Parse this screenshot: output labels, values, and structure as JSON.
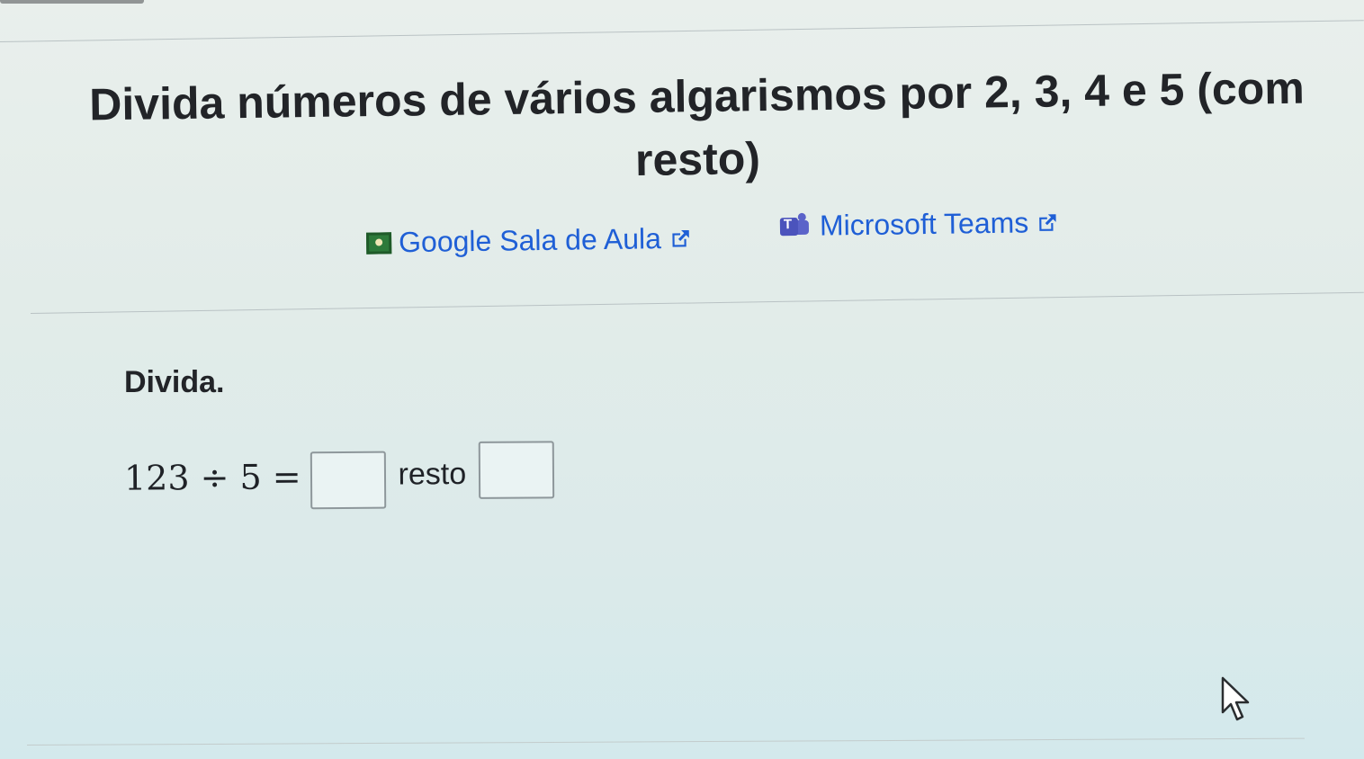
{
  "page": {
    "title": "Divida números de vários algarismos por 2, 3, 4 e 5 (com resto)",
    "share": {
      "google_label": "Google Sala de Aula",
      "teams_label": "Microsoft Teams",
      "google_icon": "google-classroom-icon",
      "teams_icon": "microsoft-teams-icon",
      "external_icon": "external-link-icon"
    }
  },
  "exercise": {
    "instruction": "Divida.",
    "expression": "123 ÷ 5 =",
    "quotient_value": "",
    "remainder_label": "resto",
    "remainder_value": ""
  },
  "colors": {
    "link": "#1f5fd6",
    "text": "#222428",
    "background": "#e2ece9"
  }
}
